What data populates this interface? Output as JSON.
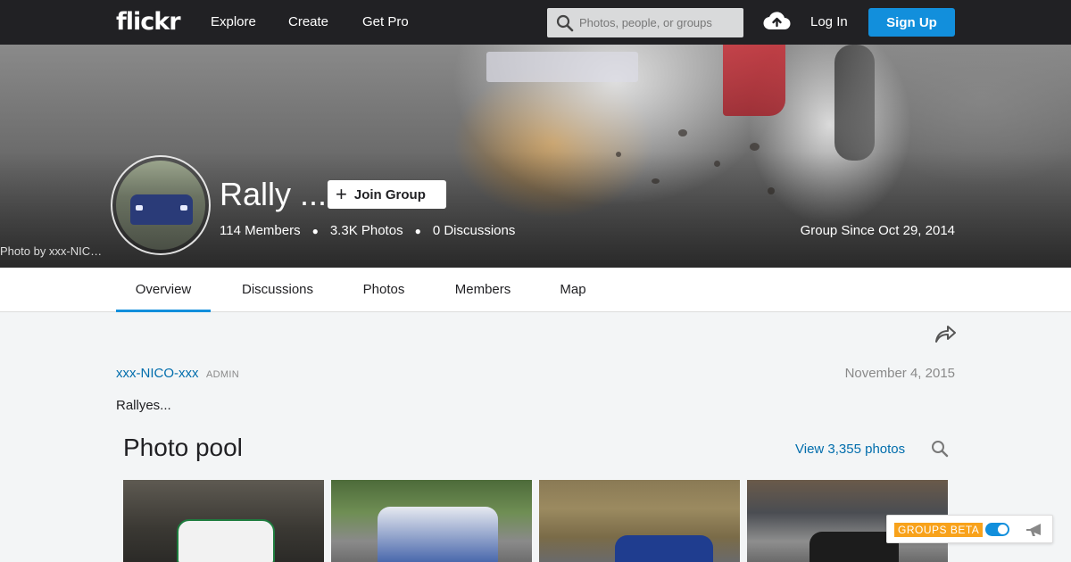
{
  "topnav": {
    "logo": "flickr",
    "links": [
      "Explore",
      "Create",
      "Get Pro"
    ],
    "search_placeholder": "Photos, people, or groups",
    "login": "Log In",
    "signup": "Sign Up"
  },
  "hero": {
    "group_name": "Rally ...",
    "join_label": "Join Group",
    "members": "114 Members",
    "photos": "3.3K Photos",
    "discussions": "0 Discussions",
    "group_since": "Group Since Oct 29, 2014",
    "photo_credit": "Photo by xxx-NICO-xxx"
  },
  "tabs": [
    {
      "label": "Overview",
      "active": true
    },
    {
      "label": "Discussions",
      "active": false
    },
    {
      "label": "Photos",
      "active": false
    },
    {
      "label": "Members",
      "active": false
    },
    {
      "label": "Map",
      "active": false
    }
  ],
  "post": {
    "author": "xxx-NICO-xxx",
    "role": "ADMIN",
    "date": "November 4, 2015",
    "text": "Rallyes..."
  },
  "pool": {
    "title": "Photo pool",
    "view_link": "View 3,355 photos"
  },
  "beta": {
    "label": "GROUPS BETA",
    "toggle_on": true
  },
  "colors": {
    "accent": "#128fdc",
    "link": "#006dac",
    "topbar": "#212124",
    "beta_orange": "#f8a21b"
  }
}
